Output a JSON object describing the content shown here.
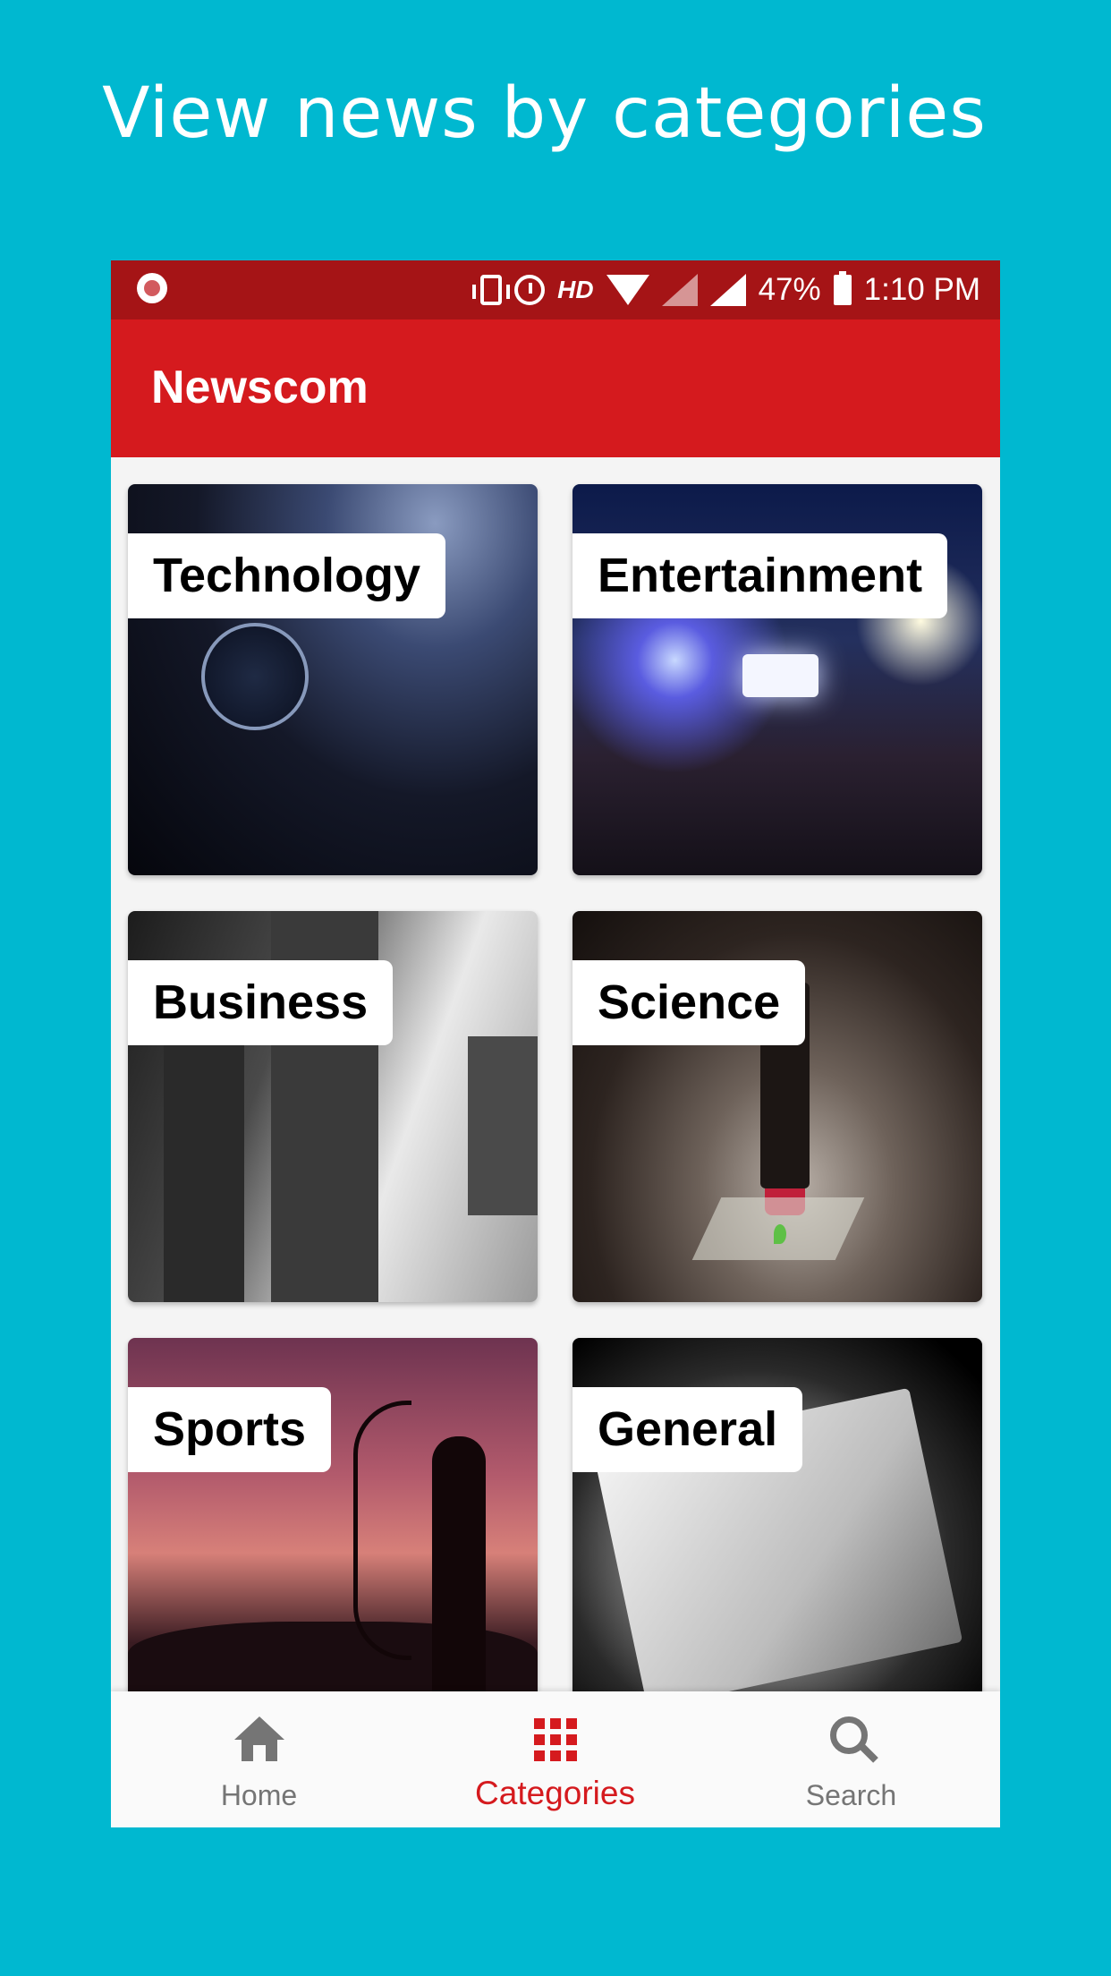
{
  "headline": "View news by categories",
  "status_bar": {
    "hd": "HD",
    "battery": "47%",
    "time": "1:10 PM",
    "icons": [
      "screen-record-icon",
      "vibrate-icon",
      "alarm-icon",
      "hd-icon",
      "wifi-icon",
      "no-signal-icon",
      "signal-icon",
      "battery-icon"
    ]
  },
  "app_bar": {
    "title": "Newscom"
  },
  "categories": [
    {
      "label": "Technology"
    },
    {
      "label": "Entertainment"
    },
    {
      "label": "Business"
    },
    {
      "label": "Science"
    },
    {
      "label": "Sports"
    },
    {
      "label": "General"
    }
  ],
  "bottom_nav": {
    "items": [
      {
        "label": "Home",
        "icon": "home-icon"
      },
      {
        "label": "Categories",
        "icon": "grid-icon",
        "active": true
      },
      {
        "label": "Search",
        "icon": "search-icon"
      }
    ]
  },
  "colors": {
    "background": "#00b8d0",
    "status_bar": "#a51416",
    "app_bar": "#d51a1e",
    "active_nav": "#d51a1e",
    "inactive_nav": "#757575"
  }
}
